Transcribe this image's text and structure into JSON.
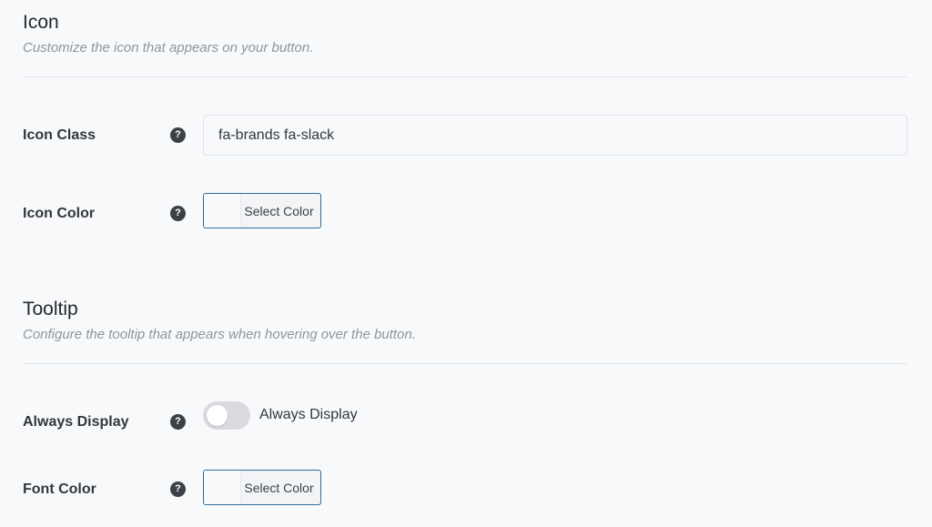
{
  "icon_section": {
    "title": "Icon",
    "description": "Customize the icon that appears on your button.",
    "fields": {
      "icon_class": {
        "label": "Icon Class",
        "value": "fa-brands fa-slack",
        "help_icon": "question-circle-icon"
      },
      "icon_color": {
        "label": "Icon Color",
        "button_label": "Select Color",
        "help_icon": "question-circle-icon"
      }
    }
  },
  "tooltip_section": {
    "title": "Tooltip",
    "description": "Configure the tooltip that appears when hovering over the button.",
    "fields": {
      "always_display": {
        "label": "Always Display",
        "toggle_label": "Always Display",
        "toggle_on": false,
        "help_icon": "question-circle-icon"
      },
      "font_color": {
        "label": "Font Color",
        "button_label": "Select Color",
        "help_icon": "question-circle-icon"
      }
    }
  },
  "colors": {
    "accent_border": "#2d6e99",
    "help_icon_bg": "#3c4148",
    "toggle_off": "#d9dbe0"
  }
}
